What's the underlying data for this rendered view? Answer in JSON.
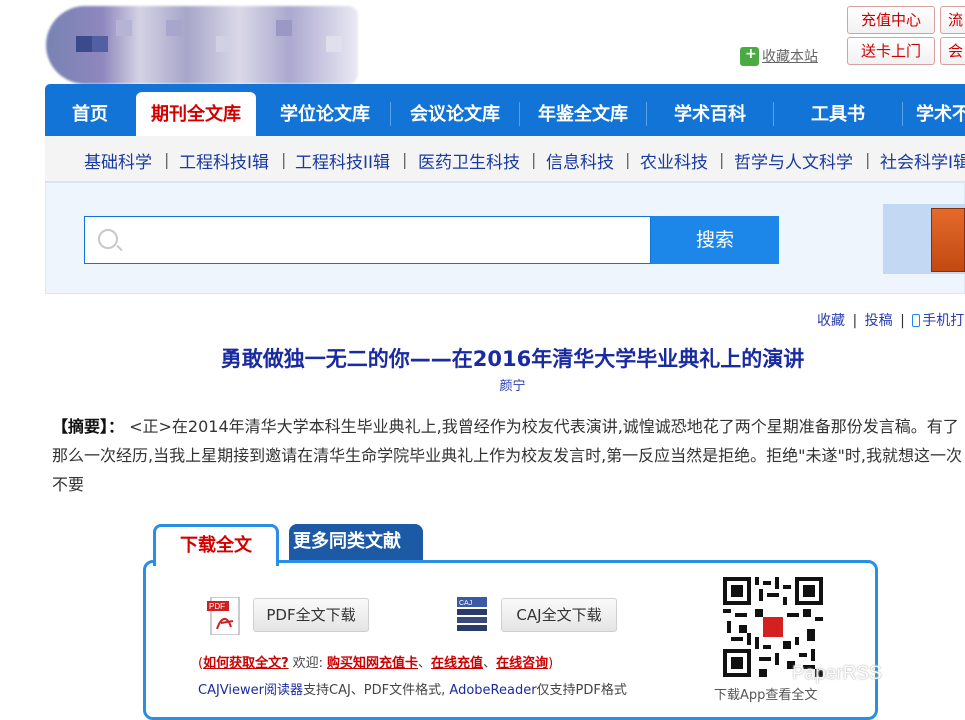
{
  "top_buttons": {
    "recharge": "充值中心",
    "flow": "流",
    "delivery": "送卡上门",
    "member": "会"
  },
  "favorite": "收藏本站",
  "main_nav": [
    "首页",
    "期刊全文库",
    "学位论文库",
    "会议论文库",
    "年鉴全文库",
    "学术百科",
    "工具书",
    "学术不"
  ],
  "sub_nav": [
    "基础科学",
    "工程科技I辑",
    "工程科技II辑",
    "医药卫生科技",
    "信息科技",
    "农业科技",
    "哲学与人文科学",
    "社会科学I辑"
  ],
  "search": {
    "button": "搜索",
    "placeholder": ""
  },
  "links": {
    "collect": "收藏",
    "submit": "投稿",
    "mobile": "手机打开"
  },
  "article": {
    "title": "勇敢做独一无二的你——在2016年清华大学毕业典礼上的演讲",
    "author": "颜宁",
    "abstract_label": "【摘要】：",
    "abstract": " <正>在2014年清华大学本科生毕业典礼上,我曾经作为校友代表演讲,诚惶诚恐地花了两个星期准备那份发言稿。有了那么一次经历,当我上星期接到邀请在清华生命学院毕业典礼上作为校友发言时,第一反应当然是拒绝。拒绝\"未遂\"时,我就想这一次不要"
  },
  "download": {
    "tab_full": "下载全文",
    "tab_more": "更多同类文献",
    "pdf_button": "PDF全文下载",
    "caj_button": "CAJ全文下载",
    "howto": "如何获取全文?",
    "welcome": "欢迎:",
    "buy_card": "购买知网充值卡",
    "online_recharge": "在线充值",
    "online_consult": "在线咨询",
    "caj_viewer": "CAJViewer阅读器",
    "caj_support": "支持CAJ、PDF文件格式,",
    "adobe": "AdobeReader",
    "adobe_support": "仅支持PDF格式",
    "qr_caption": "下载App查看全文"
  },
  "watermark": "PaperRSS"
}
